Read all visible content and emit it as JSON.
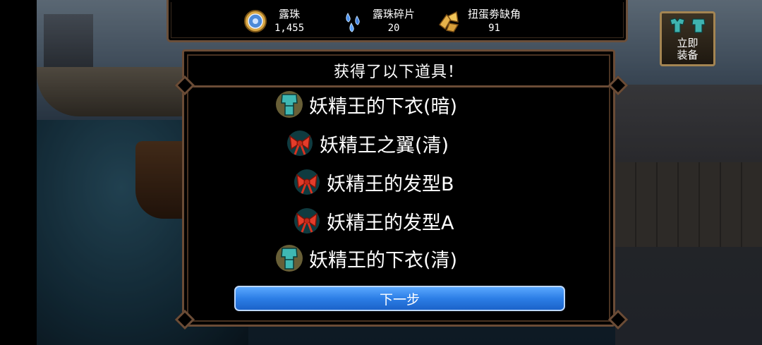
{
  "currencies": [
    {
      "name": "露珠",
      "value": "1,455",
      "icon": "dew-orb-icon"
    },
    {
      "name": "露珠碎片",
      "value": "20",
      "icon": "dew-shard-icon"
    },
    {
      "name": "扭蛋劵缺角",
      "value": "91",
      "icon": "gacha-ticket-fragment-icon"
    }
  ],
  "dialog": {
    "title": "获得了以下道具！",
    "items": [
      {
        "label": "妖精王的下衣(暗)",
        "icon": "armor-icon"
      },
      {
        "label": "妖精王之翼(清)",
        "icon": "ribbon-icon"
      },
      {
        "label": "妖精王的发型B",
        "icon": "ribbon-icon"
      },
      {
        "label": "妖精王的发型A",
        "icon": "ribbon-icon"
      },
      {
        "label": "妖精王的下衣(清)",
        "icon": "armor-icon"
      }
    ],
    "next_label": "下一步"
  },
  "equip_button": {
    "label": "立即\n装备"
  },
  "colors": {
    "frame": "#6b4c36",
    "button_blue": "#2c7ee6",
    "equip_border": "#a48552"
  }
}
